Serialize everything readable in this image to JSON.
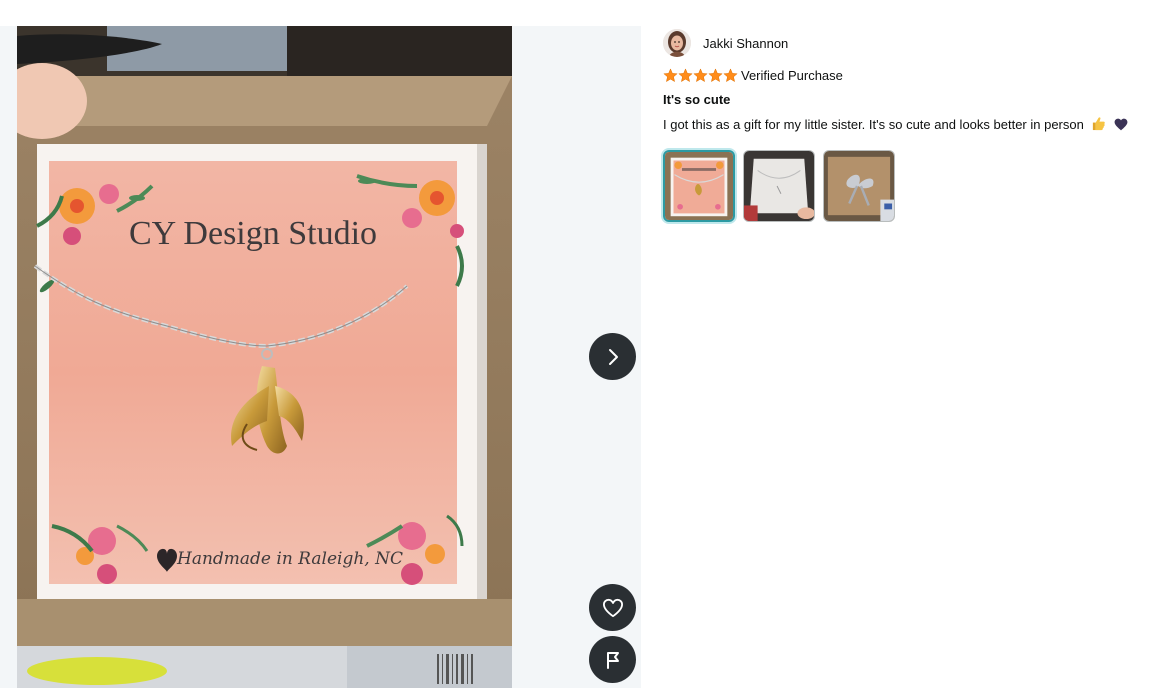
{
  "reviewer": {
    "name": "Jakki Shannon",
    "avatar_icon": "person-avatar-icon"
  },
  "rating": {
    "stars": 5,
    "max": 5,
    "star_color": "#ff8c1a",
    "verified_label": "Verified Purchase"
  },
  "review": {
    "title": "It's so cute",
    "body": "I got this as a gift for my little sister. It's so cute and looks better in person",
    "emojis": [
      "thumbs-up-icon",
      "purple-heart-icon"
    ]
  },
  "media": {
    "photo_caption": "CY Design Studio",
    "photo_tagline": "Handmade in Raleigh, NC",
    "thumbnails": [
      {
        "name": "thumbnail-necklace-card",
        "selected": true
      },
      {
        "name": "thumbnail-white-box",
        "selected": false
      },
      {
        "name": "thumbnail-gift-bow",
        "selected": false
      }
    ],
    "next_icon": "chevron-right-icon",
    "like_icon": "heart-outline-icon",
    "report_icon": "flag-icon"
  }
}
